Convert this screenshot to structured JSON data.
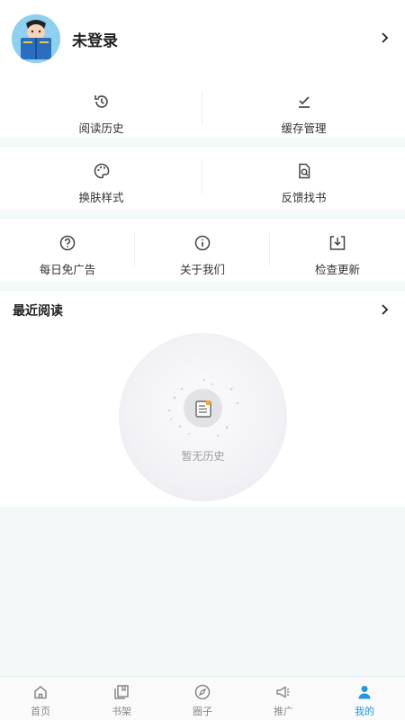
{
  "profile": {
    "name": "未登录"
  },
  "menu_row1": [
    {
      "label": "阅读历史",
      "icon": "history-icon"
    },
    {
      "label": "缓存管理",
      "icon": "download-check-icon"
    }
  ],
  "menu_row2": [
    {
      "label": "换肤样式",
      "icon": "palette-icon"
    },
    {
      "label": "反馈找书",
      "icon": "search-doc-icon"
    }
  ],
  "menu_row3": [
    {
      "label": "每日免广告",
      "icon": "help-circle-icon"
    },
    {
      "label": "关于我们",
      "icon": "info-icon"
    },
    {
      "label": "检查更新",
      "icon": "update-download-icon"
    }
  ],
  "recent": {
    "title": "最近阅读",
    "empty_text": "暂无历史"
  },
  "tabbar": [
    {
      "label": "首页",
      "icon": "home-icon",
      "active": false
    },
    {
      "label": "书架",
      "icon": "bookshelf-icon",
      "active": false
    },
    {
      "label": "圈子",
      "icon": "compass-icon",
      "active": false
    },
    {
      "label": "推广",
      "icon": "megaphone-icon",
      "active": false
    },
    {
      "label": "我的",
      "icon": "user-icon",
      "active": true
    }
  ],
  "colors": {
    "accent": "#2196e6",
    "background": "#f3f8f9"
  }
}
